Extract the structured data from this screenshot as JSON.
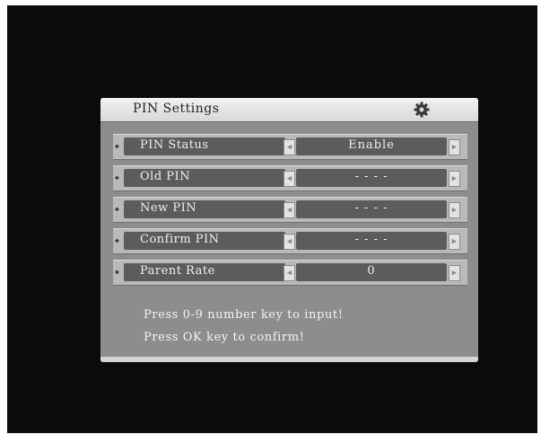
{
  "dialog": {
    "title": "PIN Settings",
    "icon": "gear-icon"
  },
  "rows": [
    {
      "label": "PIN Status",
      "value": "Enable"
    },
    {
      "label": "Old PIN",
      "value": "- - - -"
    },
    {
      "label": "New PIN",
      "value": "- - - -"
    },
    {
      "label": "Confirm PIN",
      "value": "- - - -"
    },
    {
      "label": "Parent Rate",
      "value": "0"
    }
  ],
  "hints": {
    "line1": "Press 0-9 number key to input!",
    "line2": "Press OK key to confirm!"
  },
  "colors": {
    "screen": "#0b0b0b",
    "dialog": "#8d8d8d",
    "field": "#5c5c5c",
    "text": "#f0f0f0"
  }
}
